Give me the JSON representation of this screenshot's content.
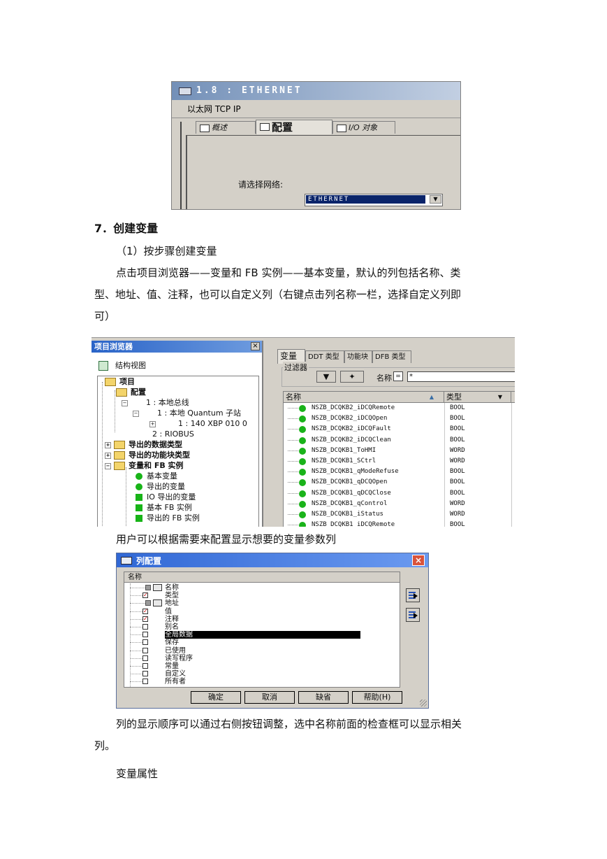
{
  "shot1": {
    "title": "1.8 : ETHERNET",
    "subtitle": "以太网 TCP IP",
    "tabs": [
      "概述",
      "配置",
      "I/O 对象"
    ],
    "network_label": "请选择网络:",
    "network_value": "ETHERNET"
  },
  "doc": {
    "heading": "7．创建变量",
    "step1": "（1）按步骤创建变量",
    "para1_line1": "点击项目浏览器——变量和 FB 实例——基本变量，默认的列包括名称、类",
    "para1_line2": "型、地址、值、注释，也可以自定义列（右键点击列名称一栏，选择自定义列即",
    "para1_line3": "可）",
    "para2": "用户可以根据需要来配置显示想要的变量参数列",
    "para3_line1": "列的显示顺序可以通过右侧按钮调整，选中名称前面的检查框可以显示相关",
    "para3_line2": "列。",
    "para4": "变量属性"
  },
  "browser": {
    "title": "项目浏览器",
    "close": "×",
    "view": "结构视图",
    "tree": [
      "项目",
      "配置",
      "1 : 本地总线",
      "1 : 本地 Quantum 子站",
      "1 : 140 XBP 010 0",
      "2 : RIOBUS",
      "导出的数据类型",
      "导出的功能块类型",
      "变量和 FB 实例",
      "基本变量",
      "导出的变量",
      "IO 导出的变量",
      "基本 FB 实例",
      "导出的 FB 实例"
    ]
  },
  "varpane": {
    "tabs": [
      "变量",
      "DDT 类型",
      "功能块",
      "DFB 类型"
    ],
    "filter_label": "过滤器",
    "name_label": "名称",
    "eq": "=",
    "filter_value": "*",
    "col_name": "名称",
    "col_type": "类型",
    "sort_up": "▲",
    "sort_down": "▼",
    "rows": [
      {
        "name": "NSZB_DCQKB2_iDCQRemote",
        "type": "BOOL"
      },
      {
        "name": "NSZB_DCQKB2_iDCQOpen",
        "type": "BOOL"
      },
      {
        "name": "NSZB_DCQKB2_iDCQFault",
        "type": "BOOL"
      },
      {
        "name": "NSZB_DCQKB2_iDCQClean",
        "type": "BOOL"
      },
      {
        "name": "NSZB_DCQKB1_ToHMI",
        "type": "WORD"
      },
      {
        "name": "NSZB_DCQKB1_SCtrl",
        "type": "WORD"
      },
      {
        "name": "NSZB_DCQKB1_qModeRefuse",
        "type": "BOOL"
      },
      {
        "name": "NSZB_DCQKB1_qDCQOpen",
        "type": "BOOL"
      },
      {
        "name": "NSZB_DCQKB1_qDCQClose",
        "type": "BOOL"
      },
      {
        "name": "NSZB_DCQKB1_qControl",
        "type": "WORD"
      },
      {
        "name": "NSZB_DCQKB1_iStatus",
        "type": "WORD"
      },
      {
        "name": "NSZB_DCQKB1_iDCQRemote",
        "type": "BOOL"
      }
    ]
  },
  "colcfg": {
    "title": "列配置",
    "close": "×",
    "header": "名称",
    "items": [
      {
        "label": "名称",
        "state": "locked"
      },
      {
        "label": "类型",
        "state": "checked"
      },
      {
        "label": "地址",
        "state": "locked"
      },
      {
        "label": "值",
        "state": "checked"
      },
      {
        "label": "注释",
        "state": "checked"
      },
      {
        "label": "别名",
        "state": "unchecked"
      },
      {
        "label": "全局数据",
        "state": "selected"
      },
      {
        "label": "保存",
        "state": "unchecked"
      },
      {
        "label": "已使用",
        "state": "unchecked"
      },
      {
        "label": "读写程序",
        "state": "unchecked"
      },
      {
        "label": "常量",
        "state": "unchecked"
      },
      {
        "label": "自定义",
        "state": "unchecked"
      },
      {
        "label": "所有者",
        "state": "unchecked"
      }
    ],
    "buttons": [
      "确定",
      "取消",
      "缺省",
      "帮助(H)"
    ]
  }
}
